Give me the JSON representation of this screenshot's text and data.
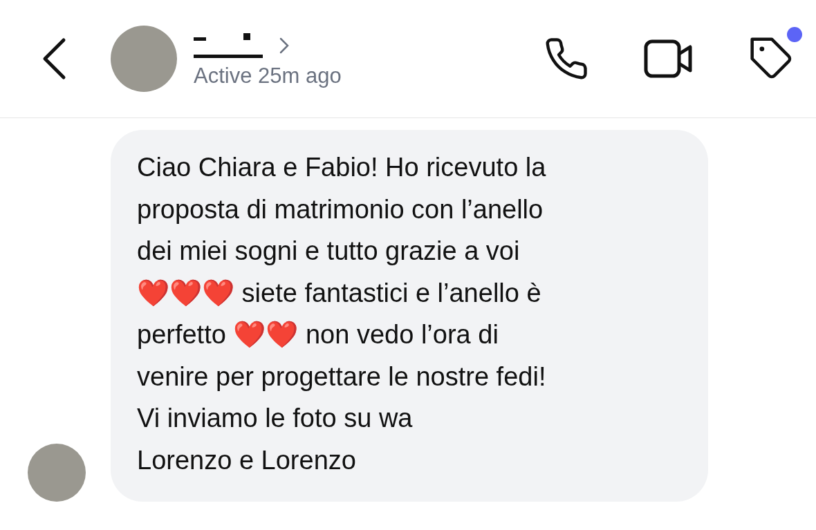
{
  "header": {
    "status": "Active 25m ago",
    "tag_notification": true
  },
  "message": {
    "text": "Ciao Chiara e Fabio! Ho ricevuto la\nproposta di matrimonio con l’anello\ndei miei sogni e tutto grazie a voi\n❤️❤️❤️ siete fantastici e l’anello è\nperfetto ❤️❤️ non vedo l’ora di\nvenire per progettare le nostre fedi!\nVi inviamo le foto su wa\nLorenzo e Lorenzo"
  }
}
